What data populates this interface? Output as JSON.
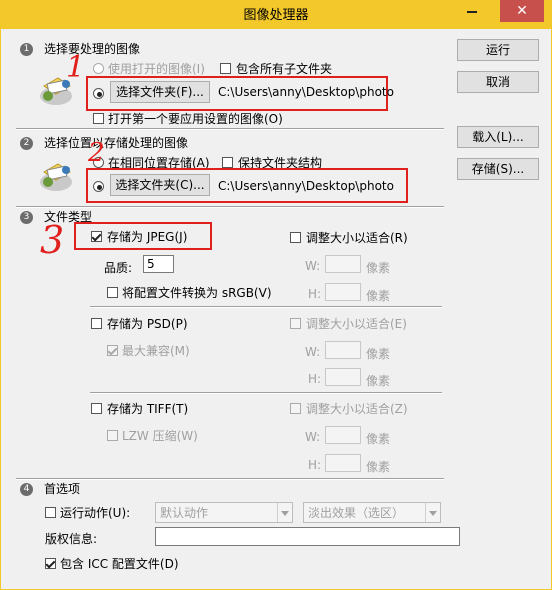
{
  "window": {
    "title": "图像处理器",
    "close_glyph": "✕"
  },
  "section1": {
    "number": "1",
    "heading": "选择要处理的图像",
    "use_open_images": "使用打开的图像(I)",
    "include_subfolders": "包含所有子文件夹",
    "choose_folder_button": "选择文件夹(F)...",
    "path": "C:\\Users\\anny\\Desktop\\photo",
    "open_first_image": "打开第一个要应用设置的图像(O)"
  },
  "section2": {
    "number": "2",
    "heading": "选择位置以存储处理的图像",
    "same_location": "在相同位置存储(A)",
    "keep_structure": "保持文件夹结构",
    "choose_folder_button": "选择文件夹(C)...",
    "path": "C:\\Users\\anny\\Desktop\\photo"
  },
  "section3": {
    "number": "3",
    "heading": "文件类型",
    "jpeg": {
      "save_as": "存储为 JPEG(J)",
      "resize": "调整大小以适合(R)",
      "quality_label": "品质:",
      "quality_value": "5",
      "w_label": "W:",
      "h_label": "H:",
      "unit": "像素",
      "convert_srgb": "将配置文件转换为 sRGB(V)"
    },
    "psd": {
      "save_as": "存储为 PSD(P)",
      "resize": "调整大小以适合(E)",
      "maximize": "最大兼容(M)",
      "w_label": "W:",
      "h_label": "H:",
      "unit": "像素"
    },
    "tiff": {
      "save_as": "存储为 TIFF(T)",
      "resize": "调整大小以适合(Z)",
      "lzw": "LZW 压缩(W)",
      "w_label": "W:",
      "h_label": "H:",
      "unit": "像素"
    }
  },
  "section4": {
    "number": "4",
    "heading": "首选项",
    "run_action": "运行动作(U):",
    "action_set": "默认动作",
    "action": "淡出效果（选区）",
    "copyright_label": "版权信息:",
    "include_icc": "包含 ICC 配置文件(D)"
  },
  "side_buttons": {
    "run": "运行",
    "cancel": "取消",
    "load": "载入(L)...",
    "save": "存储(S)..."
  },
  "annotations": {
    "one": "1",
    "two": "2",
    "three": "3"
  },
  "colors": {
    "titlebar": "#f2c82a",
    "close": "#c7504c",
    "highlight_box": "#e0201c"
  }
}
